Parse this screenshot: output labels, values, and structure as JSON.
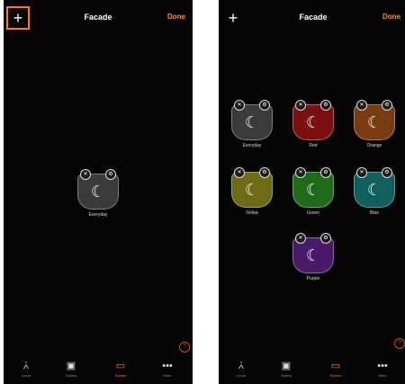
{
  "app": {
    "title": "Facade",
    "done_label": "Done",
    "plus_label": "+"
  },
  "screens": {
    "left": {
      "tiles": [
        {
          "label": "Everyday",
          "color": "#3a3a3a"
        }
      ]
    },
    "right": {
      "tiles": [
        {
          "label": "Everyday",
          "color": "#3a3a3a"
        },
        {
          "label": "Red",
          "color": "#7a1010"
        },
        {
          "label": "Orange",
          "color": "#7a3a10"
        },
        {
          "label": "Yellow",
          "color": "#6f6a14"
        },
        {
          "label": "Green",
          "color": "#1f6b1a"
        },
        {
          "label": "Blue",
          "color": "#0f5f5f"
        },
        {
          "label": "Purple",
          "color": "#4a1a6a"
        }
      ]
    }
  },
  "tile_badges": {
    "left": "✕",
    "right": "⚙"
  },
  "moon_glyph": "☾",
  "help_glyph": "?",
  "tabbar": [
    {
      "label": "Lunar",
      "icon": "lamp-icon"
    },
    {
      "label": "Gallery",
      "icon": "gallery-icon"
    },
    {
      "label": "Screen",
      "icon": "screen-icon",
      "active": true
    },
    {
      "label": "More",
      "icon": "more-icon"
    }
  ],
  "tab_glyphs": [
    "⩑",
    "▣",
    "▭",
    "•••"
  ],
  "colors": {
    "accent": "#ff8a1f",
    "highlight": "#ff7a1a",
    "background": "#050505"
  }
}
